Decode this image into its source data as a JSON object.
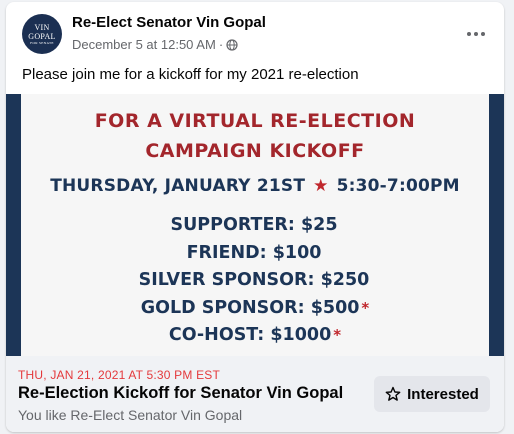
{
  "post": {
    "page_name": "Re-Elect Senator Vin Gopal",
    "timestamp": "December 5 at 12:50 AM",
    "separator": "·",
    "text": "Please join me for a kickoff for my 2021 re-election"
  },
  "avatar": {
    "line1a": "VIN",
    "line1b": "GOPAL",
    "line2": "FOR SENATE"
  },
  "flyer": {
    "title_line1": "FOR A VIRTUAL RE-ELECTION",
    "title_line2": "CAMPAIGN KICKOFF",
    "date": "THURSDAY, JANUARY 21ST",
    "time": "5:30-7:00PM",
    "tiers": [
      {
        "label": "SUPPORTER: $25",
        "asterisk": ""
      },
      {
        "label": "FRIEND: $100",
        "asterisk": ""
      },
      {
        "label": "SILVER SPONSOR: $250",
        "asterisk": ""
      },
      {
        "label": "GOLD SPONSOR: $500",
        "asterisk": "*"
      },
      {
        "label": "CO-HOST: $1000",
        "asterisk": "*"
      }
    ]
  },
  "event": {
    "date": "THU, JAN 21, 2021 AT 5:30 PM EST",
    "title": "Re-Election Kickoff for Senator Vin Gopal",
    "subtitle": "You like Re-Elect Senator Vin Gopal",
    "button_label": "Interested"
  },
  "colors": {
    "flyer_red": "#a3262c",
    "flyer_navy": "#1c3557",
    "event_date_red": "#e4393c"
  },
  "icons": {
    "globe": "globe-icon",
    "more": "more-options-icon",
    "star": "star-icon",
    "interested": "star-outline-icon"
  }
}
